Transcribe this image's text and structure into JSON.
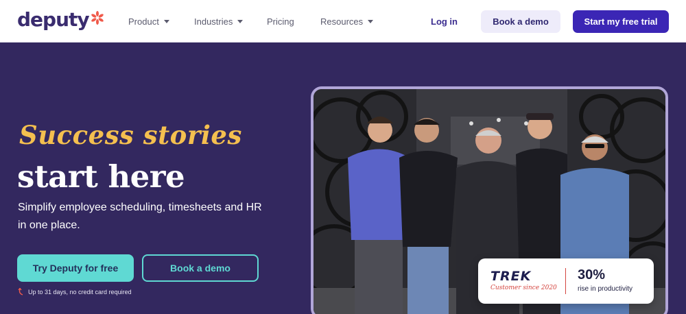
{
  "nav": {
    "logo_text": "deputy",
    "links": [
      {
        "label": "Product"
      },
      {
        "label": "Industries"
      },
      {
        "label": "Pricing"
      },
      {
        "label": "Resources"
      }
    ],
    "login": "Log in",
    "book_demo": "Book a demo",
    "start_trial": "Start my free trial"
  },
  "hero": {
    "script_title": "Success stories",
    "title": "start here",
    "subtitle": "Simplify employee scheduling, timesheets and HR in one place.",
    "try_button": "Try Deputy for free",
    "demo_button": "Book a demo",
    "note": "Up to 31 days, no credit card required"
  },
  "testimonial": {
    "brand": "TREK",
    "customer_since": "Customer since 2020",
    "stat_value": "30%",
    "stat_label": "rise in productivity"
  },
  "colors": {
    "background": "#33285f",
    "accent_teal": "#5fd9d3",
    "accent_gold": "#f4bf4f",
    "primary_button": "#3b26b5",
    "logo_star": "#f05a4a"
  }
}
